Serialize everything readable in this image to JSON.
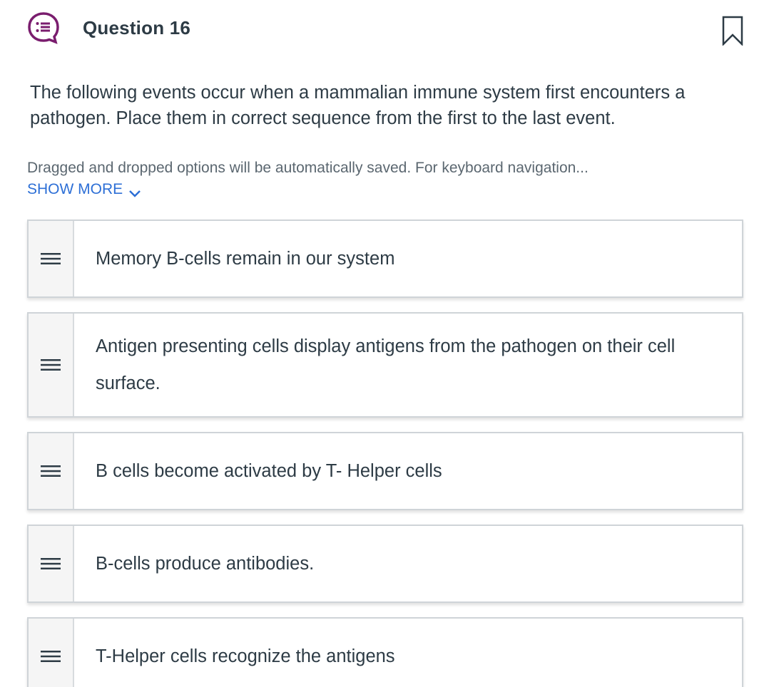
{
  "question": {
    "title": "Question 16",
    "prompt": "The following events occur when a mammalian immune system first encounters a pathogen. Place them in correct sequence from the first to the last event."
  },
  "instructions": {
    "text": "Dragged and dropped options will be automatically saved. For keyboard navigation...",
    "show_more_label": "SHOW MORE"
  },
  "options": [
    {
      "label": "Memory B-cells remain in our system"
    },
    {
      "label": "Antigen presenting cells display antigens from the pathogen on their cell surface."
    },
    {
      "label": "B cells become activated by T- Helper cells"
    },
    {
      "label": "B-cells produce antibodies."
    },
    {
      "label": "T-Helper cells recognize the antigens"
    }
  ],
  "colors": {
    "accent_purple": "#7a1d6e",
    "link_blue": "#2d6fd6",
    "text": "#2d3b45"
  },
  "icons": {
    "question_icon": "list-bubble-icon",
    "bookmark_icon": "bookmark-icon",
    "drag_handle_icon": "drag-handle-icon",
    "show_more_icon": "chevron-down-icon"
  }
}
